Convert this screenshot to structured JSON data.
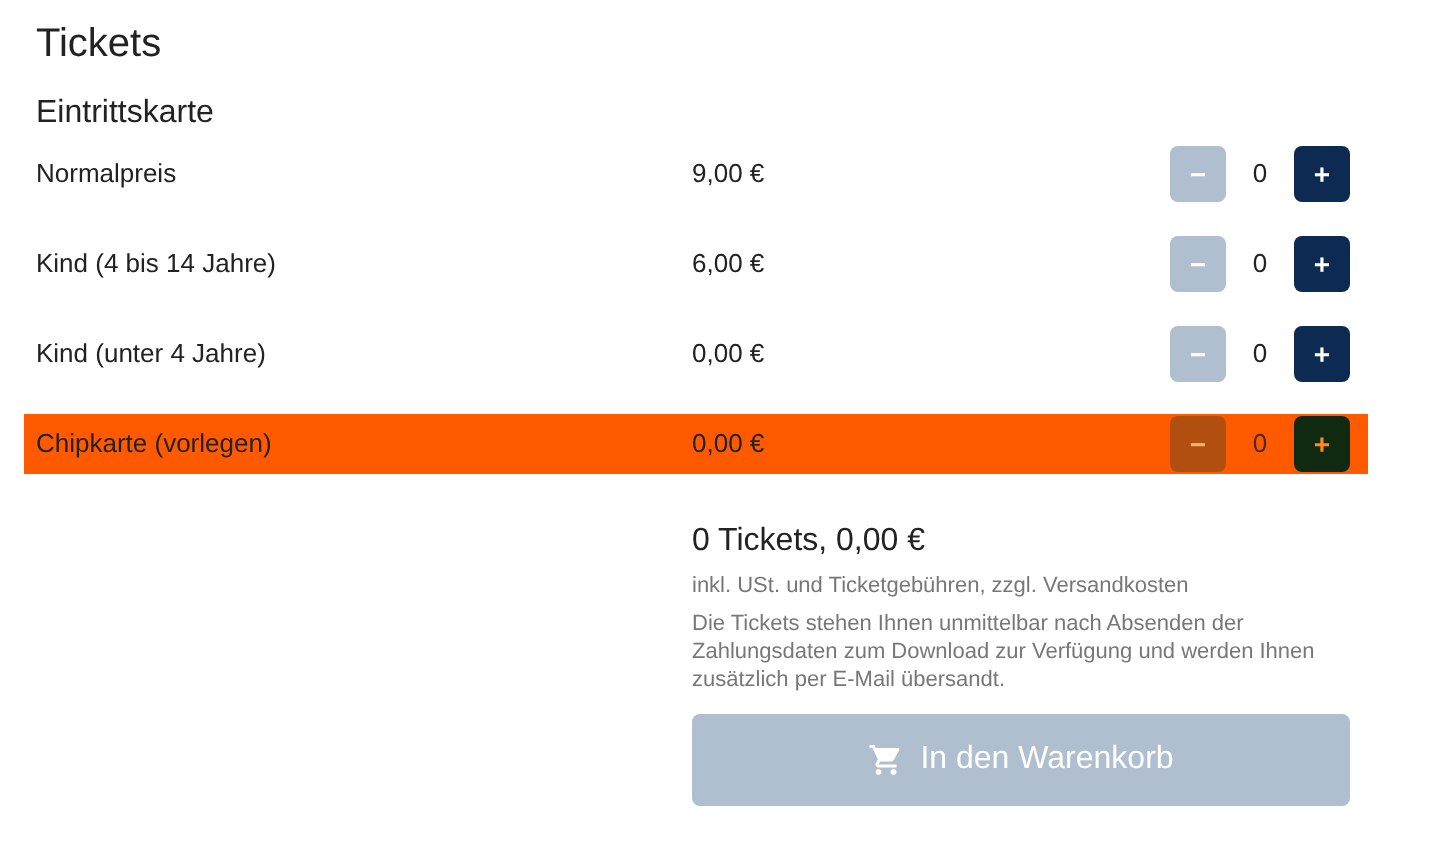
{
  "title": "Tickets",
  "section": "Eintrittskarte",
  "tickets": [
    {
      "name": "Normalpreis",
      "price": "9,00 €",
      "minus": "−",
      "count": "0",
      "plus": "+",
      "minus_disabled": true,
      "highlighted": false
    },
    {
      "name": "Kind (4 bis 14 Jahre)",
      "price": "6,00 €",
      "minus": "−",
      "count": "0",
      "plus": "+",
      "minus_disabled": true,
      "highlighted": false
    },
    {
      "name": "Kind (unter 4 Jahre)",
      "price": "0,00 €",
      "minus": "−",
      "count": "0",
      "plus": "+",
      "minus_disabled": true,
      "highlighted": false
    },
    {
      "name": "Chipkarte (vorlegen)",
      "price": "0,00 €",
      "minus": "−",
      "count": "0",
      "plus": "+",
      "minus_disabled": true,
      "highlighted": true
    }
  ],
  "summary": {
    "total": "0 Tickets, 0,00 €",
    "tax_note": "inkl. USt. und Ticketgebühren, zzgl. Versandkosten",
    "delivery_note": "Die Tickets stehen Ihnen unmittelbar nach Absenden der Zahlungsdaten zum Download zur Verfügung und werden Ihnen zusätzlich per E-Mail übersandt."
  },
  "cart_button": {
    "label": "In den Warenkorb",
    "disabled": true
  }
}
